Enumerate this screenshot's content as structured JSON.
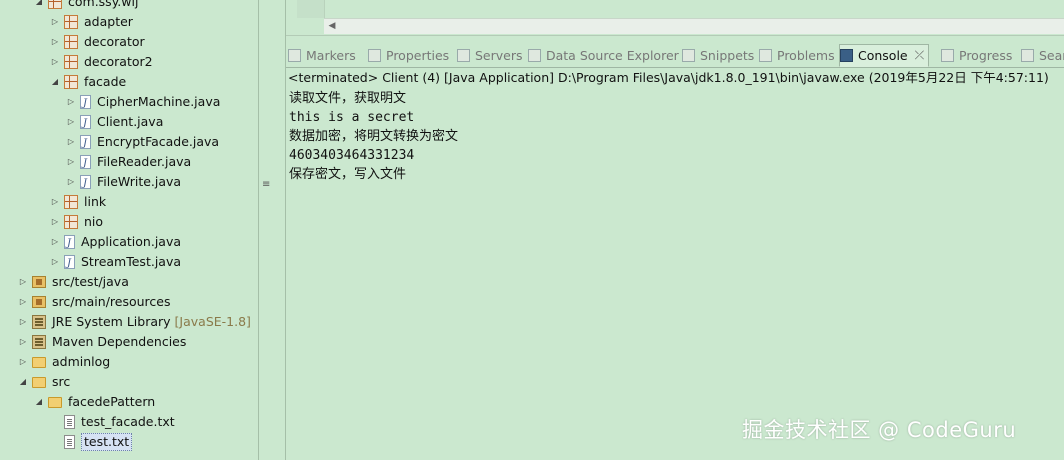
{
  "tree": {
    "items": [
      {
        "label": "com.ssy.wlj",
        "icon": "package-icon",
        "twisty": "expanded"
      },
      {
        "label": "adapter",
        "icon": "package-icon",
        "twisty": "collapsed"
      },
      {
        "label": "decorator",
        "icon": "package-icon",
        "twisty": "collapsed"
      },
      {
        "label": "decorator2",
        "icon": "package-icon",
        "twisty": "collapsed"
      },
      {
        "label": "facade",
        "icon": "package-icon",
        "twisty": "expanded"
      },
      {
        "label": "CipherMachine.java",
        "icon": "java-file-icon",
        "twisty": "collapsed"
      },
      {
        "label": "Client.java",
        "icon": "java-file-icon",
        "twisty": "collapsed"
      },
      {
        "label": "EncryptFacade.java",
        "icon": "java-file-icon",
        "twisty": "collapsed"
      },
      {
        "label": "FileReader.java",
        "icon": "java-file-icon",
        "twisty": "collapsed"
      },
      {
        "label": "FileWrite.java",
        "icon": "java-file-icon",
        "twisty": "collapsed"
      },
      {
        "label": "link",
        "icon": "package-icon",
        "twisty": "collapsed"
      },
      {
        "label": "nio",
        "icon": "package-icon",
        "twisty": "collapsed"
      },
      {
        "label": "Application.java",
        "icon": "java-file-icon",
        "twisty": "collapsed"
      },
      {
        "label": "StreamTest.java",
        "icon": "java-file-icon",
        "twisty": "collapsed"
      },
      {
        "label": "src/test/java",
        "icon": "source-folder-icon",
        "twisty": "collapsed"
      },
      {
        "label": "src/main/resources",
        "icon": "source-folder-icon",
        "twisty": "collapsed"
      },
      {
        "label": "JRE System Library",
        "decoration": "[JavaSE-1.8]",
        "icon": "library-icon",
        "twisty": "collapsed"
      },
      {
        "label": "Maven Dependencies",
        "icon": "library-icon",
        "twisty": "collapsed"
      },
      {
        "label": "adminlog",
        "icon": "folder-icon",
        "twisty": "collapsed"
      },
      {
        "label": "src",
        "icon": "folder-icon",
        "twisty": "expanded"
      },
      {
        "label": "facedePattern",
        "icon": "folder-icon",
        "twisty": "expanded"
      },
      {
        "label": "test_facade.txt",
        "icon": "text-file-icon",
        "twisty": "none"
      },
      {
        "label": "test.txt",
        "icon": "text-file-icon",
        "twisty": "none",
        "selected": true
      }
    ]
  },
  "views": {
    "tabs": [
      {
        "label": "Markers",
        "icon": "markers-icon"
      },
      {
        "label": "Properties",
        "icon": "properties-icon"
      },
      {
        "label": "Servers",
        "icon": "servers-icon"
      },
      {
        "label": "Data Source Explorer",
        "icon": "data-source-icon"
      },
      {
        "label": "Snippets",
        "icon": "snippets-icon"
      },
      {
        "label": "Problems",
        "icon": "problems-icon"
      },
      {
        "label": "Console",
        "icon": "console-icon",
        "active": true
      },
      {
        "label": "Progress",
        "icon": "progress-icon"
      },
      {
        "label": "Sear",
        "icon": "search-icon"
      }
    ],
    "close_glyph": "⤫"
  },
  "console": {
    "status": "<terminated> Client (4) [Java Application] D:\\Program Files\\Java\\jdk1.8.0_191\\bin\\javaw.exe (2019年5月22日 下午4:57:11)",
    "lines": [
      "读取文件，获取明文",
      "this is a secret",
      "数据加密，将明文转换为密文",
      "4603403464331234",
      "保存密文，写入文件"
    ]
  },
  "watermark": "掘金技术社区 @ CodeGuru",
  "colors": {
    "background": "#cbe8cf",
    "selection": "#d6e2f3",
    "decoration": "#8a7a4a"
  }
}
